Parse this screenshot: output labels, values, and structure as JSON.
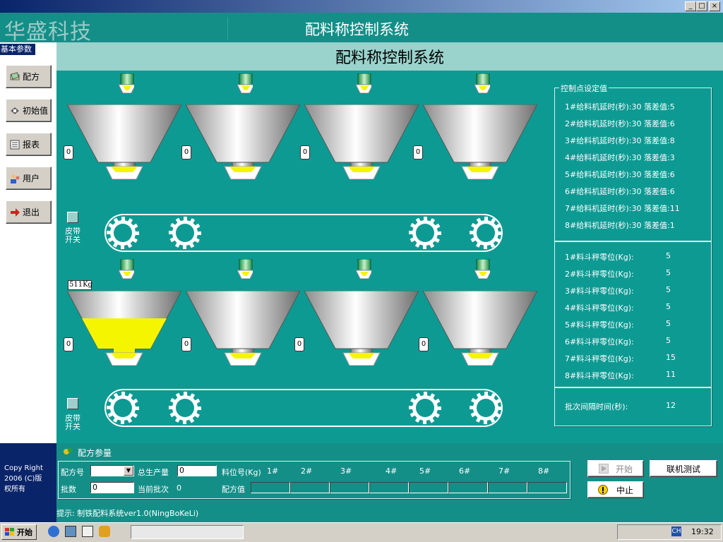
{
  "window": {
    "min": "_",
    "restore": "□",
    "close": "×"
  },
  "header": {
    "logo": "华盛科技",
    "title": "配料称控制系统"
  },
  "sidebar": {
    "section_label": "基本参数",
    "items": [
      {
        "label": "配方",
        "icon": "recipe-book-icon"
      },
      {
        "label": "初始值",
        "icon": "init-value-icon"
      },
      {
        "label": "报表",
        "icon": "report-icon"
      },
      {
        "label": "用户",
        "icon": "user-icon"
      },
      {
        "label": "退出",
        "icon": "exit-arrow-icon"
      }
    ],
    "copyright": [
      "Copy Right",
      "2006 (C)版",
      "权所有"
    ]
  },
  "main": {
    "subtitle": "配料称控制系统",
    "row1_hopper_values": [
      "0",
      "0",
      "0",
      "0"
    ],
    "row2_hopper_values": [
      "0",
      "0",
      "0",
      "0"
    ],
    "belt_label_1": "皮带",
    "belt_label_2": "开关",
    "weight": "511Kg",
    "hopper1_row2_fill_level": 0.55
  },
  "control": {
    "title": "控制点设定值",
    "delays": [
      "1#给料机延时(秒):30 落差值:5",
      "2#给料机延时(秒):30 落差值:6",
      "3#给料机延时(秒):30 落差值:8",
      "4#给料机延时(秒):30 落差值:3",
      "5#给料机延时(秒):30 落差值:6",
      "6#给料机延时(秒):30 落差值:6",
      "7#给料机延时(秒):30 落差值:11",
      "8#给料机延时(秒):30 落差值:1"
    ],
    "zeros": [
      {
        "label": "1#料斗秤零位(Kg):",
        "value": "5"
      },
      {
        "label": "2#料斗秤零位(Kg):",
        "value": "5"
      },
      {
        "label": "3#料斗秤零位(Kg):",
        "value": "5"
      },
      {
        "label": "4#料斗秤零位(Kg):",
        "value": "5"
      },
      {
        "label": "5#料斗秤零位(Kg):",
        "value": "5"
      },
      {
        "label": "6#料斗秤零位(Kg):",
        "value": "5"
      },
      {
        "label": "7#料斗秤零位(Kg):",
        "value": "15"
      },
      {
        "label": "8#料斗秤零位(Kg):",
        "value": "11"
      }
    ],
    "interval_label": "批次间隔时间(秒):",
    "interval_value": "12"
  },
  "recipe": {
    "title": "配方参量",
    "recipe_no_label": "配方号",
    "total_label": "总生产量",
    "total_value": "0",
    "position_label": "料位号(Kg)",
    "positions": [
      "1#",
      "2#",
      "3#",
      "4#",
      "5#",
      "6#",
      "7#",
      "8#"
    ],
    "batch_label": "批数",
    "batch_value": "0",
    "current_batch_label": "当前批次",
    "current_batch_value": "0",
    "recipe_value_label": "配方值"
  },
  "buttons": {
    "start": "开始",
    "online_test": "联机测试",
    "stop": "中止"
  },
  "status": {
    "text": "提示: 制铁配料系统ver1.0(NingBoKeLi)"
  },
  "taskbar": {
    "start": "开始",
    "clock": "19:32",
    "lang": "CH"
  },
  "colors": {
    "teal": "#0d9a93",
    "header": "#148f88",
    "accent_yellow": "#f5f500"
  }
}
